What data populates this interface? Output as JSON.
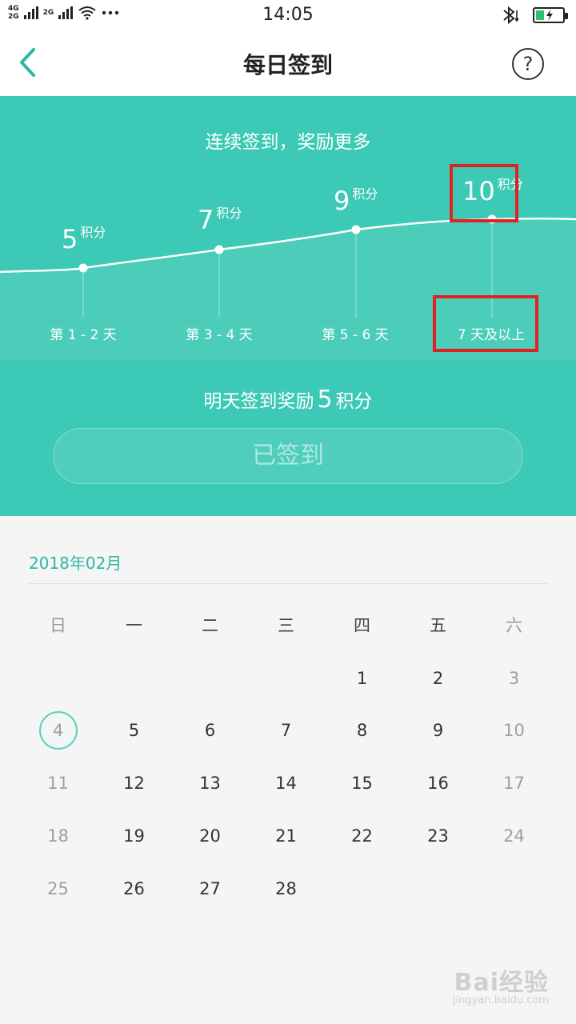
{
  "status_bar": {
    "net1": "4G",
    "net2": "2G",
    "net3": "2G",
    "time": "14:05",
    "icons": [
      "signal-icon",
      "wifi-icon",
      "more-icon",
      "bluetooth-icon",
      "battery-icon"
    ]
  },
  "header": {
    "title": "每日签到",
    "help_label": "?"
  },
  "hero": {
    "subtitle": "连续签到，奖励更多",
    "points": [
      {
        "value": "5",
        "unit": "积分",
        "day": "第 1 - 2 天"
      },
      {
        "value": "7",
        "unit": "积分",
        "day": "第 3 - 4 天"
      },
      {
        "value": "9",
        "unit": "积分",
        "day": "第 5 - 6 天"
      },
      {
        "value": "10",
        "unit": "积分",
        "day": "7 天及以上"
      }
    ],
    "reward_prefix": "明天签到奖励",
    "reward_value": "5",
    "reward_suffix": "积分",
    "signed_button": "已签到",
    "colors": {
      "background": "#3cc9b5",
      "highlight": "#e02222"
    }
  },
  "calendar": {
    "month": "2018年02月",
    "weekdays": [
      "日",
      "一",
      "二",
      "三",
      "四",
      "五",
      "六"
    ],
    "today": "4",
    "rows": [
      [
        "",
        "",
        "",
        "",
        "1",
        "2",
        "3"
      ],
      [
        "4",
        "5",
        "6",
        "7",
        "8",
        "9",
        "10"
      ],
      [
        "11",
        "12",
        "13",
        "14",
        "15",
        "16",
        "17"
      ],
      [
        "18",
        "19",
        "20",
        "21",
        "22",
        "23",
        "24"
      ],
      [
        "25",
        "26",
        "27",
        "28",
        "",
        "",
        ""
      ]
    ],
    "accent": "#2ab8a3"
  },
  "watermark": {
    "main": "Bai经验",
    "url": "jingyan.baidu.com"
  }
}
